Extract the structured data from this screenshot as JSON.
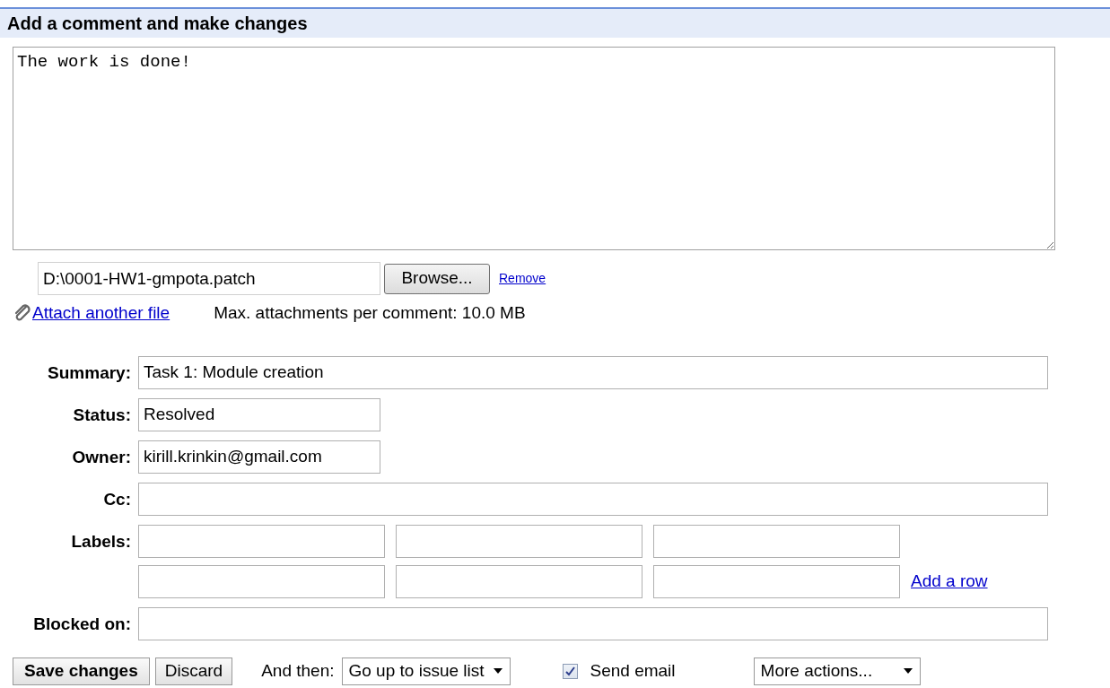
{
  "section": {
    "title": "Add a comment and make changes"
  },
  "comment": {
    "value": "The work is done!"
  },
  "attachment": {
    "file": "D:\\0001-HW1-gmpota.patch",
    "browse": "Browse...",
    "remove": "Remove",
    "attach_another": "Attach another file",
    "limit": "Max. attachments per comment: 10.0 MB"
  },
  "fields": [
    {
      "label": "Summary:",
      "value": "Task 1: Module creation",
      "kind": "wide"
    },
    {
      "label": "Status:",
      "value": "Resolved",
      "kind": "short"
    },
    {
      "label": "Owner:",
      "value": "kirill.krinkin@gmail.com",
      "kind": "short"
    },
    {
      "label": "Cc:",
      "kind": "wide"
    },
    {
      "label": "Labels:",
      "kind": "labels",
      "add_row": "Add a row"
    },
    {
      "label": "Blocked on:",
      "kind": "wide"
    }
  ],
  "actions": {
    "save": "Save changes",
    "discard": "Discard",
    "and_then_label": "And then:",
    "and_then_value": "Go up to issue list",
    "send_email": {
      "label": "Send email",
      "checked": true
    },
    "more": "More actions..."
  }
}
